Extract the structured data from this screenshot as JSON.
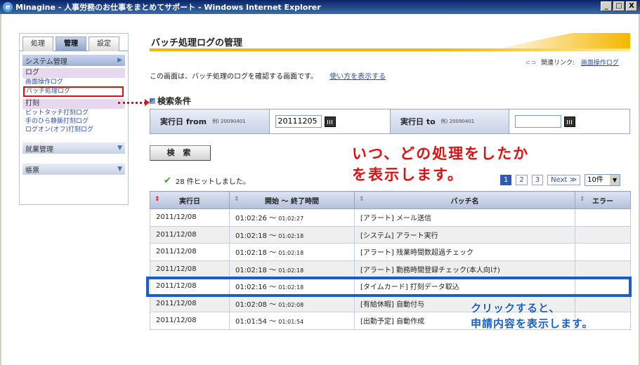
{
  "window": {
    "title": "Minagine - 人事労務のお仕事をまとめてサポート - Windows Internet Explorer",
    "buttons": [
      "_",
      "□",
      "X"
    ]
  },
  "sidebar": {
    "tabs": [
      "処理",
      "管理",
      "設定"
    ],
    "active_tab": "管理",
    "sections": [
      {
        "label": "システム管理",
        "groups": [
          {
            "label": "ログ",
            "links": [
              "画面操作ログ",
              "バッチ処理ログ"
            ]
          },
          {
            "label": "打刻",
            "links": [
              "ピットタッチ打刻ログ",
              "手のひら静脈打刻ログ",
              "ログオン(オフ)打刻ログ"
            ]
          }
        ]
      },
      {
        "label": "就業管理"
      },
      {
        "label": "帳票"
      }
    ]
  },
  "main": {
    "title": "バッチ処理ログの管理",
    "related_label": "関連リンク:",
    "related_link": "画面操作ログ",
    "description": "この画面は、バッチ処理のログを確認する画面です。",
    "help_link": "使い方を表示する",
    "search_header": "検索条件",
    "from_label": "実行日 from",
    "from_example": "例) 20090401",
    "from_value": "20111205",
    "to_label": "実行日 to",
    "to_example": "例) 20090401",
    "to_value": "",
    "search_button": "検 索",
    "hits_text": "28 件ヒットしました。",
    "pager": {
      "pages": [
        "1",
        "2",
        "3"
      ],
      "current": "1",
      "next": "Next ≫",
      "per_page": "10件"
    },
    "columns": [
      "実行日",
      "開始 ～ 終了時間",
      "バッチ名",
      "エラー"
    ],
    "rows": [
      {
        "date": "2011/12/08",
        "start": "01:02:26",
        "end": "01:02:27",
        "name": "[アラート] メール送信",
        "error": ""
      },
      {
        "date": "2011/12/08",
        "start": "01:02:18",
        "end": "01:02:18",
        "name": "[システム] アラート実行",
        "error": ""
      },
      {
        "date": "2011/12/08",
        "start": "01:02:18",
        "end": "01:02:18",
        "name": "[アラート] 残業時間数超過チェック",
        "error": ""
      },
      {
        "date": "2011/12/08",
        "start": "01:02:18",
        "end": "01:02:18",
        "name": "[アラート] 勤務時間登録チェック(本人向け)",
        "error": ""
      },
      {
        "date": "2011/12/08",
        "start": "01:02:16",
        "end": "01:02:18",
        "name": "[タイムカード] 打刻データ取込",
        "error": ""
      },
      {
        "date": "2011/12/08",
        "start": "01:02:08",
        "end": "01:02:08",
        "name": "[有給休暇] 自動付与",
        "error": ""
      },
      {
        "date": "2011/12/08",
        "start": "01:01:54",
        "end": "01:01:54",
        "name": "[出勤予定] 自動作成",
        "error": ""
      }
    ]
  },
  "annotations": {
    "red_line1": "いつ、どの処理をしたか",
    "red_line2": "を表示します。",
    "blue_line1": "クリックすると、",
    "blue_line2": "申請内容を表示します。"
  },
  "colors": {
    "accent_red": "#e01010",
    "accent_blue": "#1a5fc8",
    "title_bar": "#f6b700"
  }
}
